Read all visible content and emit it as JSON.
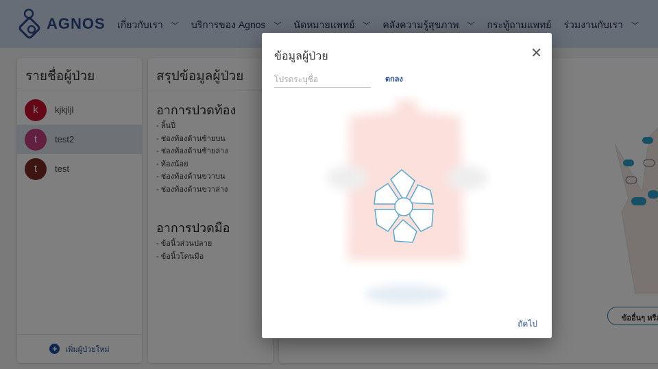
{
  "header": {
    "brand": "AGNOS",
    "nav": [
      {
        "label": "เกี่ยวกับเรา",
        "has_dropdown": true
      },
      {
        "label": "บริการของ Agnos",
        "has_dropdown": true
      },
      {
        "label": "นัดหมายแพทย์",
        "has_dropdown": true
      },
      {
        "label": "คลังความรู้สุขภาพ",
        "has_dropdown": true
      },
      {
        "label": "กระทู้ถามแพทย์",
        "has_dropdown": false
      },
      {
        "label": "ร่วมงานกับเรา",
        "has_dropdown": true
      }
    ]
  },
  "patients": {
    "title": "รายชื่อผู้ป่วย",
    "items": [
      {
        "initial": "k",
        "name": "kjkjljl",
        "color": "#c8102e"
      },
      {
        "initial": "t",
        "name": "test2",
        "color": "#c2407e",
        "selected": true
      },
      {
        "initial": "t",
        "name": "test",
        "color": "#7a2a22"
      }
    ],
    "add_label": "เพิ่มผู้ป่วยใหม่"
  },
  "summary": {
    "title": "สรุปข้อมูลผู้ป่วย",
    "groups": [
      {
        "heading": "อาการปวดท้อง",
        "items": [
          "- ลิ้นปี่",
          "- ช่องท้องด้านซ้ายบน",
          "- ช่องท้องด้านซ้ายล่าง",
          "- ท้องน้อย",
          "- ช่องท้องด้านขวาบน",
          "- ช่องท้องด้านขวาล่าง"
        ]
      },
      {
        "heading": "อาการปวดมือ",
        "items": [
          "- ข้อนิ้วส่วนปลาย",
          "- ข้อนิ้วโคนมือ"
        ]
      }
    ]
  },
  "main": {
    "other_button": "ข้ออื่นๆ หรือ"
  },
  "modal": {
    "title": "ข้อมูลผู้ป่วย",
    "close": "✕",
    "name_placeholder": "โปรดระบุชื่อ",
    "name_value": "",
    "ok_label": "ตกลง",
    "next_label": "ถัดไป"
  }
}
